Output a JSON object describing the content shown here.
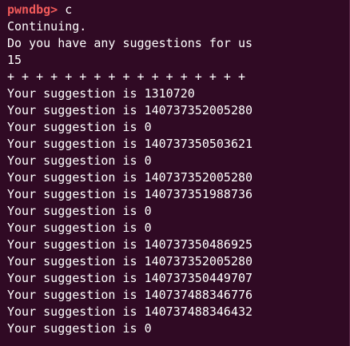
{
  "terminal": {
    "prompt": "pwndbg>",
    "command": "c",
    "lines": [
      "Continuing.",
      "Do you have any suggestions for us",
      "15",
      "+ + + + + + + + + + + + + + + + +",
      "Your suggestion is 1310720",
      "Your suggestion is 140737352005280",
      "Your suggestion is 0",
      "Your suggestion is 140737350503621",
      "Your suggestion is 0",
      "Your suggestion is 140737352005280",
      "Your suggestion is 140737351988736",
      "Your suggestion is 0",
      "Your suggestion is 0",
      "Your suggestion is 140737350486925",
      "Your suggestion is 140737352005280",
      "Your suggestion is 140737350449707",
      "Your suggestion is 140737488346776",
      "Your suggestion is 140737488346432",
      "Your suggestion is 0"
    ]
  },
  "colors": {
    "background": "#300a24",
    "prompt": "#f15a5a",
    "text": "#ffffff"
  }
}
